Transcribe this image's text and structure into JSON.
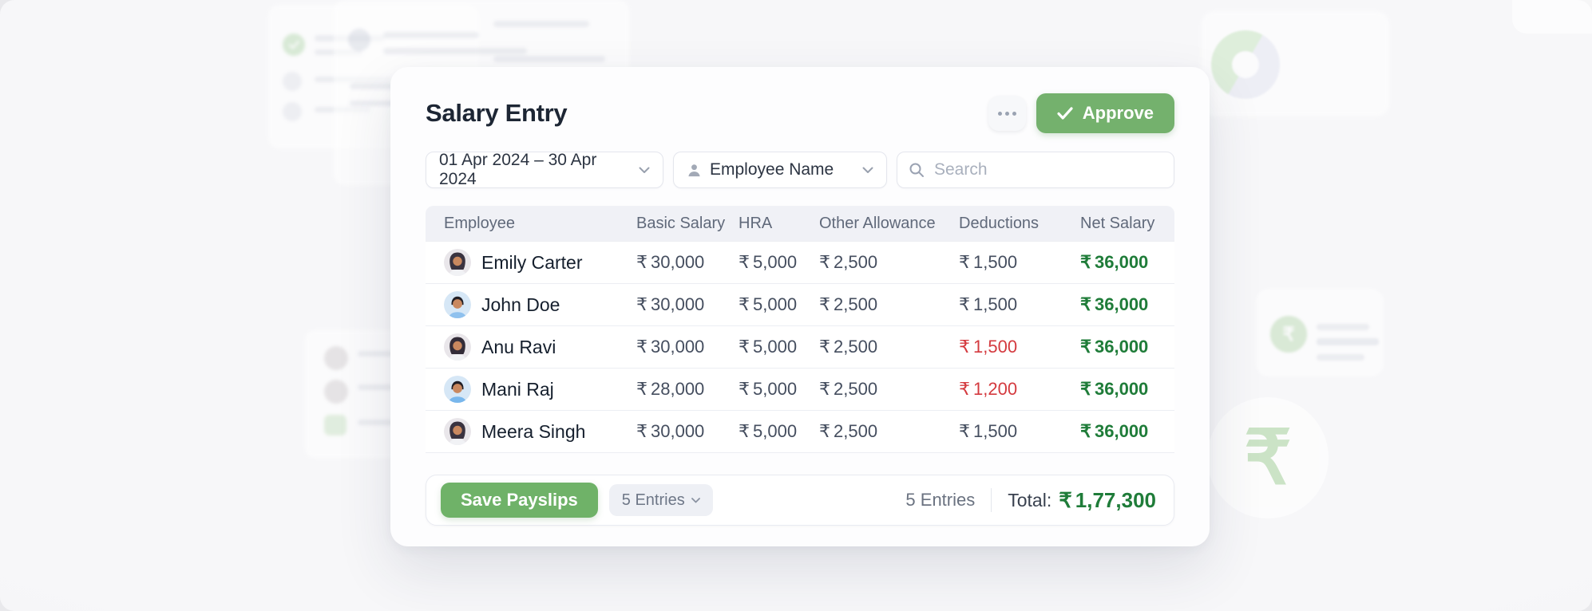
{
  "window": {
    "background": "#f5f5f7"
  },
  "card": {
    "title": "Salary Entry",
    "toolbar": {
      "approve_label": "Approve"
    },
    "filters": {
      "date_range": "01 Apr 2024 – 30 Apr 2024",
      "employee": "Employee Name",
      "search_placeholder": "Search"
    },
    "table": {
      "currency": "₹",
      "columns": [
        "Employee",
        "Basic Salary",
        "HRA",
        "Other Allowance",
        "Deductions",
        "Net Salary"
      ],
      "rows": [
        {
          "name": "Emily Carter",
          "basic": "30,000",
          "hra": "5,000",
          "other": "2,500",
          "deductions": "1,500",
          "net": "36,000",
          "deduction_highlighted": false
        },
        {
          "name": "John Doe",
          "basic": "30,000",
          "hra": "5,000",
          "other": "2,500",
          "deductions": "1,500",
          "net": "36,000",
          "deduction_highlighted": false
        },
        {
          "name": "Anu Ravi",
          "basic": "30,000",
          "hra": "5,000",
          "other": "2,500",
          "deductions": "1,500",
          "net": "36,000",
          "deduction_highlighted": true
        },
        {
          "name": "Mani Raj",
          "basic": "28,000",
          "hra": "5,000",
          "other": "2,500",
          "deductions": "1,200",
          "net": "36,000",
          "deduction_highlighted": true
        },
        {
          "name": "Meera Singh",
          "basic": "30,000",
          "hra": "5,000",
          "other": "2,500",
          "deductions": "1,500",
          "net": "36,000",
          "deduction_highlighted": false
        }
      ]
    },
    "footer": {
      "save_label": "Save Payslips",
      "entries_selector": "5 Entries",
      "entries_count": "5 Entries",
      "total_label": "Total:",
      "total_value": "1,77,300"
    }
  },
  "colors": {
    "approve_green": "#74b16d",
    "save_green": "#6fb268",
    "net_salary_green": "#1f7c39",
    "deduction_red": "#d43a3f",
    "header_bg": "#f0f1f6"
  }
}
